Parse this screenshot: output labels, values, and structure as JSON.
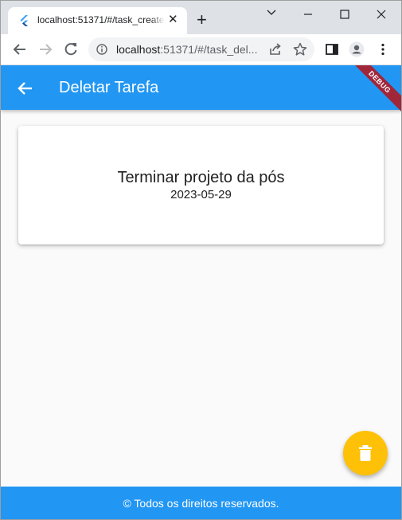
{
  "browser": {
    "tab": {
      "title": "localhost:51371/#/task_create",
      "close_icon": "close-icon"
    },
    "address_bar": {
      "host": "localhost",
      "path": ":51371/#/task_del..."
    }
  },
  "app": {
    "appbar": {
      "title": "Deletar Tarefa",
      "debug_banner": "DEBUG"
    },
    "task": {
      "name": "Terminar projeto da pós",
      "date": "2023-05-29"
    },
    "fab": {
      "icon": "trash-icon"
    },
    "footer": {
      "text": "© Todos os direitos reservados."
    }
  },
  "colors": {
    "primary": "#2196f3",
    "fab": "#ffc107",
    "debug": "#a0263a"
  }
}
